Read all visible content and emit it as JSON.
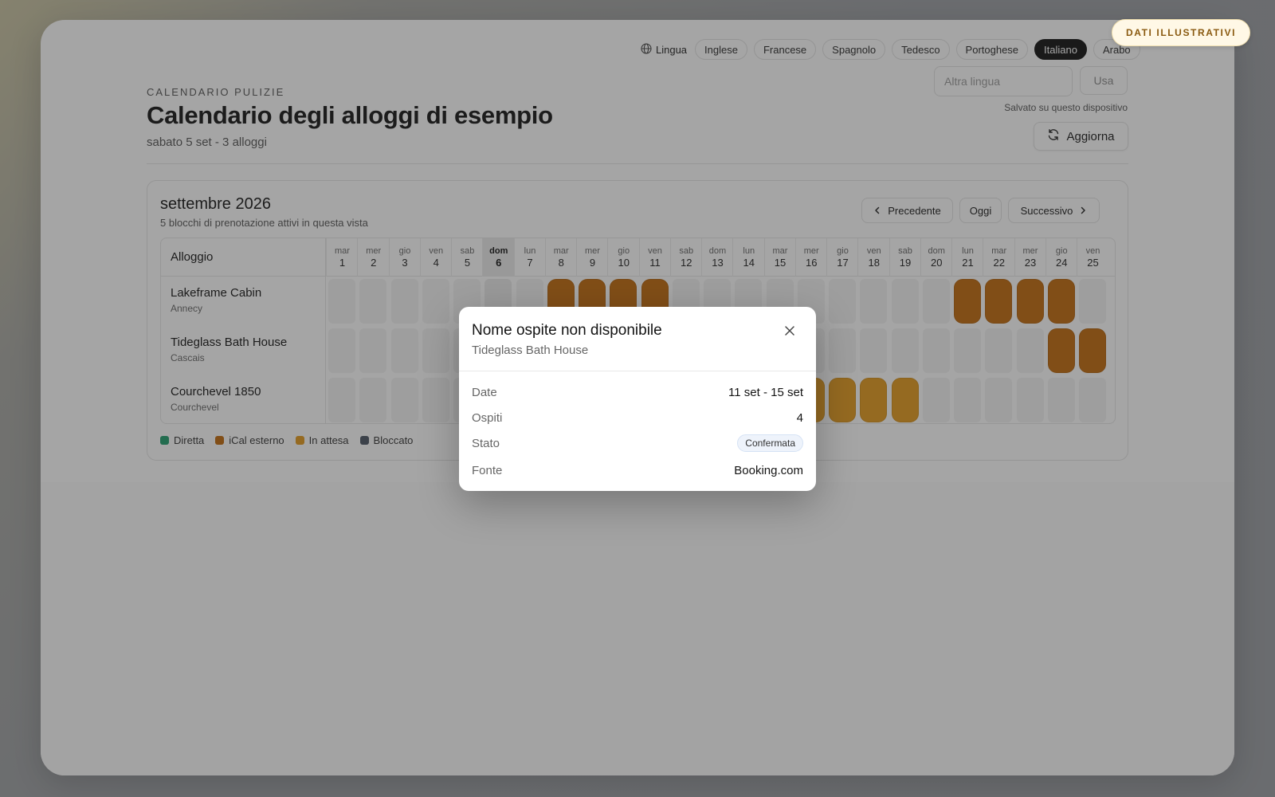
{
  "language_bar": {
    "label": "Lingua",
    "options": [
      "Inglese",
      "Francese",
      "Spagnolo",
      "Tedesco",
      "Portoghese",
      "Italiano",
      "Arabo"
    ],
    "active": "Italiano",
    "custom_placeholder": "Altra lingua",
    "use_label": "Usa",
    "saved_note": "Salvato su questo dispositivo"
  },
  "badge": "DATI ILLUSTRATIVI",
  "header": {
    "eyebrow": "CALENDARIO PULIZIE",
    "title": "Calendario degli alloggi di esempio",
    "subtitle": "sabato 5 set - 3 alloggi",
    "refresh_label": "Aggiorna"
  },
  "calendar": {
    "month": "settembre 2026",
    "summary": "5 blocchi di prenotazione attivi in questa vista",
    "prev_label": "Precedente",
    "today_label": "Oggi",
    "next_label": "Successivo",
    "property_column": "Alloggio",
    "today_day": 6,
    "days": [
      {
        "dow": "mar",
        "num": "1"
      },
      {
        "dow": "mer",
        "num": "2"
      },
      {
        "dow": "gio",
        "num": "3"
      },
      {
        "dow": "ven",
        "num": "4"
      },
      {
        "dow": "sab",
        "num": "5"
      },
      {
        "dow": "dom",
        "num": "6"
      },
      {
        "dow": "lun",
        "num": "7"
      },
      {
        "dow": "mar",
        "num": "8"
      },
      {
        "dow": "mer",
        "num": "9"
      },
      {
        "dow": "gio",
        "num": "10"
      },
      {
        "dow": "ven",
        "num": "11"
      },
      {
        "dow": "sab",
        "num": "12"
      },
      {
        "dow": "dom",
        "num": "13"
      },
      {
        "dow": "lun",
        "num": "14"
      },
      {
        "dow": "mar",
        "num": "15"
      },
      {
        "dow": "mer",
        "num": "16"
      },
      {
        "dow": "gio",
        "num": "17"
      },
      {
        "dow": "ven",
        "num": "18"
      },
      {
        "dow": "sab",
        "num": "19"
      },
      {
        "dow": "dom",
        "num": "20"
      },
      {
        "dow": "lun",
        "num": "21"
      },
      {
        "dow": "mar",
        "num": "22"
      },
      {
        "dow": "mer",
        "num": "23"
      },
      {
        "dow": "gio",
        "num": "24"
      },
      {
        "dow": "ven",
        "num": "25"
      }
    ],
    "properties": [
      {
        "name": "Lakeframe Cabin",
        "city": "Annecy",
        "bookings": [
          {
            "from": 8,
            "to": 11,
            "type": "ical"
          },
          {
            "from": 21,
            "to": 24,
            "type": "ical"
          }
        ]
      },
      {
        "name": "Tideglass Bath House",
        "city": "Cascais",
        "bookings": [
          {
            "from": 11,
            "to": 15,
            "type": "ical"
          },
          {
            "from": 24,
            "to": 25,
            "type": "ical"
          }
        ]
      },
      {
        "name": "Courchevel 1850",
        "city": "Courchevel",
        "bookings": [
          {
            "from": 13,
            "to": 19,
            "type": "pending"
          }
        ]
      }
    ],
    "legend": [
      {
        "label": "Diretta",
        "color": "#1f9d6b"
      },
      {
        "label": "iCal esterno",
        "color": "#c26a0c"
      },
      {
        "label": "In attesa",
        "color": "#e39a1c"
      },
      {
        "label": "Bloccato",
        "color": "#4b5563"
      }
    ],
    "colors": {
      "ical": "#c26a0c",
      "pending": "#e39a1c"
    }
  },
  "modal": {
    "title": "Nome ospite non disponibile",
    "subtitle": "Tideglass Bath House",
    "rows": [
      {
        "key": "Date",
        "value": "11 set - 15 set"
      },
      {
        "key": "Ospiti",
        "value": "4"
      },
      {
        "key": "Stato",
        "value": "Confermata"
      },
      {
        "key": "Fonte",
        "value": "Booking.com"
      }
    ]
  }
}
